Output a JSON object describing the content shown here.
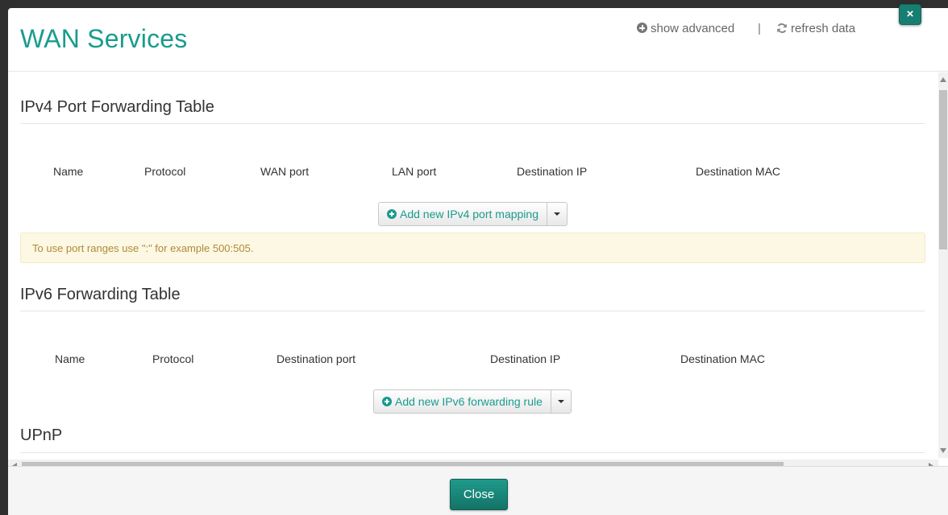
{
  "modal": {
    "title": "WAN Services",
    "show_advanced": "show advanced",
    "separator": "|",
    "refresh_data": "refresh data",
    "close_x": "×",
    "close_button": "Close"
  },
  "ipv4": {
    "title": "IPv4 Port Forwarding Table",
    "columns": [
      "Name",
      "Protocol",
      "WAN port",
      "LAN port",
      "Destination IP",
      "Destination MAC"
    ],
    "add_button": "Add new IPv4 port mapping",
    "hint": "To use port ranges use \":\" for example 500:505."
  },
  "ipv6": {
    "title": "IPv6 Forwarding Table",
    "columns": [
      "Name",
      "Protocol",
      "Destination port",
      "Destination IP",
      "Destination MAC"
    ],
    "add_button": "Add new IPv6 forwarding rule"
  },
  "upnp": {
    "title": "UPnP"
  },
  "colors": {
    "accent": "#1a9b8e",
    "button_dark": "#177e72",
    "alert_bg": "#fcf8e3",
    "alert_text": "#b08a3a"
  },
  "icons": [
    "circle-plus-icon",
    "refresh-icon",
    "close-icon",
    "chevron-down-icon"
  ]
}
